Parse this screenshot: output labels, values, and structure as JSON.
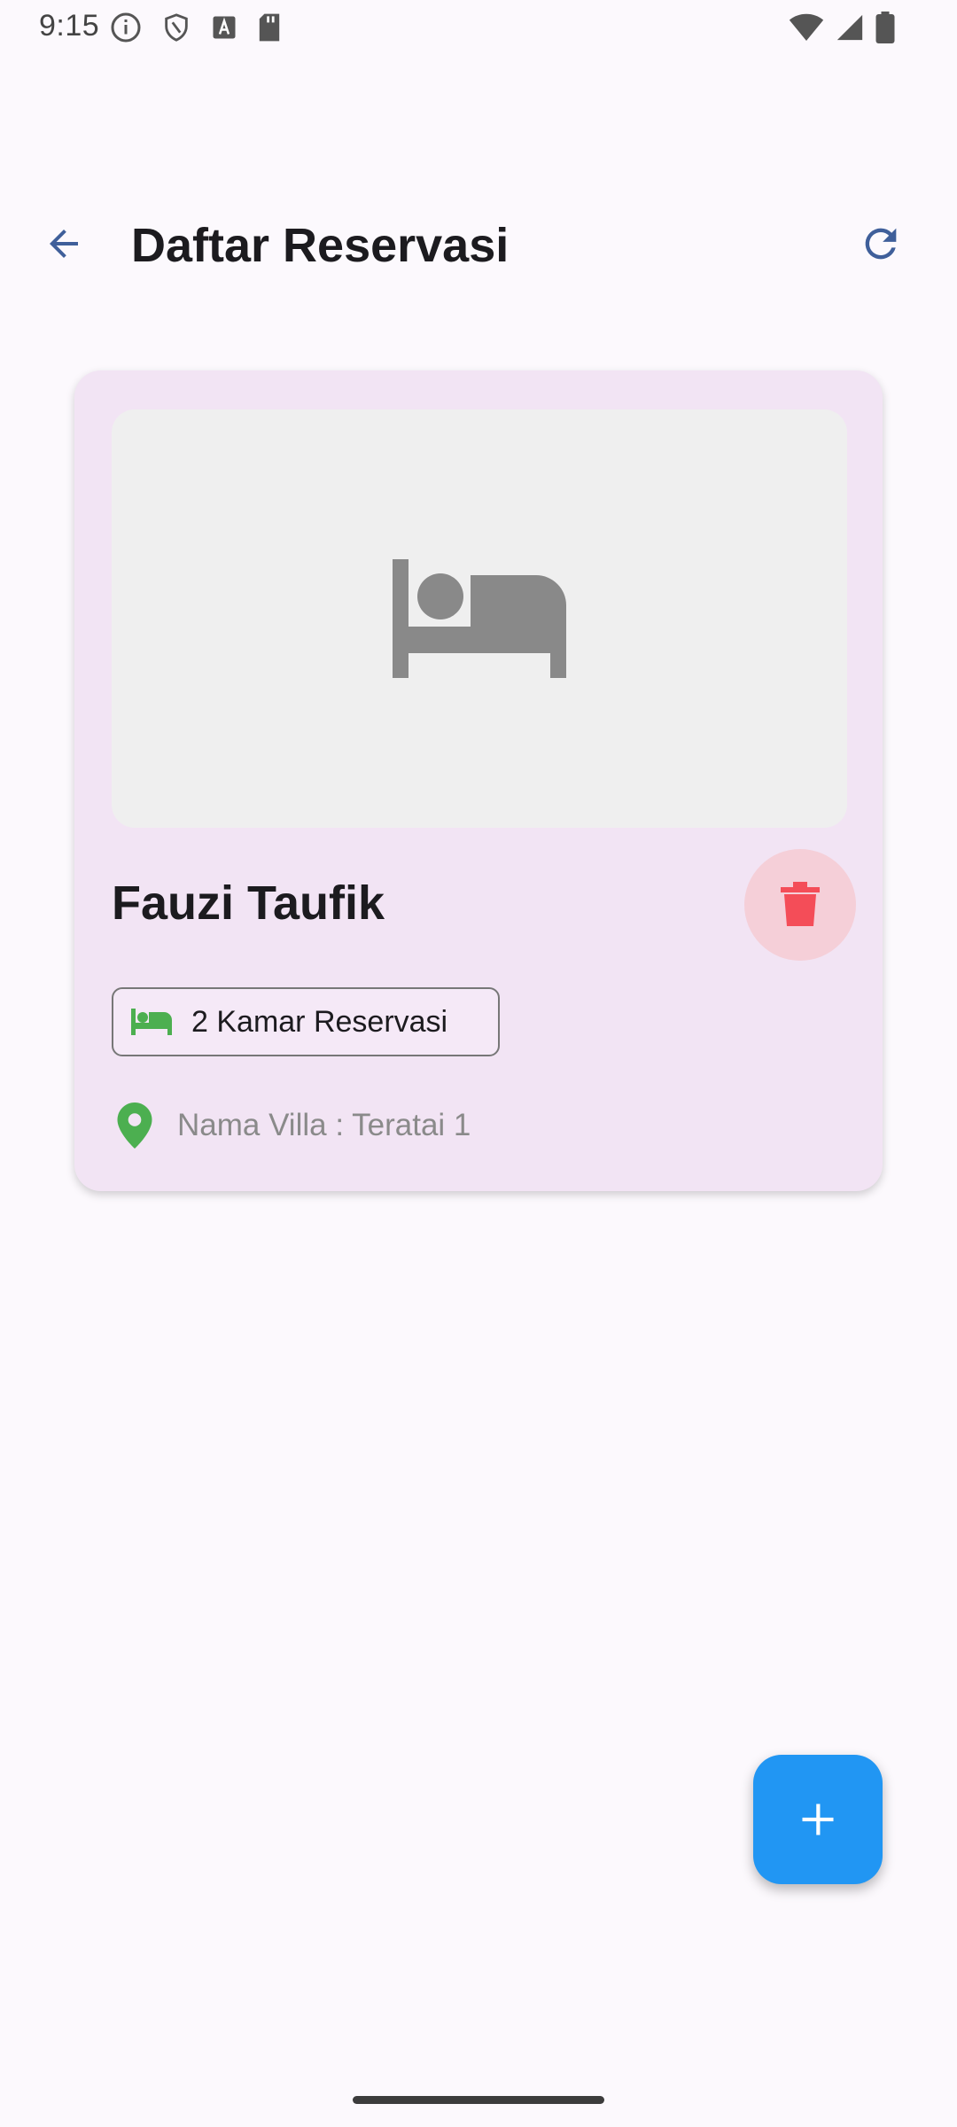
{
  "status_bar": {
    "time": "9:15",
    "left_icons": [
      "info-icon",
      "shield-icon",
      "text-a-icon",
      "sd-card-icon"
    ],
    "right_icons": [
      "wifi-icon",
      "signal-icon",
      "battery-icon"
    ]
  },
  "app_bar": {
    "title": "Daftar Reservasi",
    "back_icon": "arrow-back-icon",
    "refresh_icon": "refresh-icon"
  },
  "reservations": [
    {
      "guest_name": "Fauzi Taufik",
      "rooms_label": "2 Kamar Reservasi",
      "villa_label": "Nama Villa : Teratai 1",
      "image_placeholder_icon": "bed-icon",
      "delete_icon": "trash-icon"
    }
  ],
  "fab": {
    "icon": "plus-icon"
  },
  "colors": {
    "background": "#fcf9fd",
    "card": "#f2e4f4",
    "accent_blue": "#2196f3",
    "delete_red": "#f44d58",
    "delete_bg": "#f5cfd8",
    "green": "#4caf50",
    "icon_blue": "#3f5f9a"
  }
}
